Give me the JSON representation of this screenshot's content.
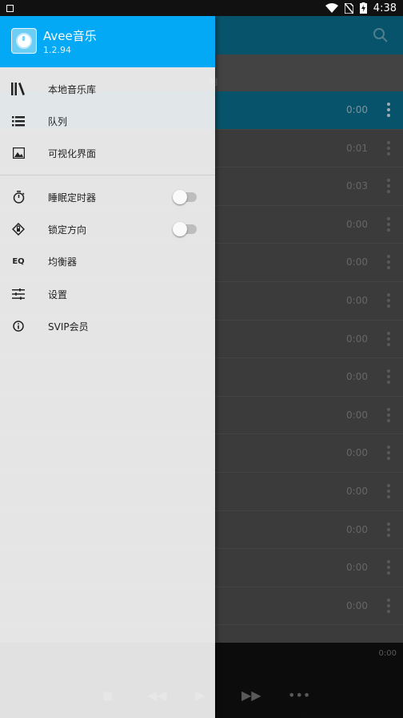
{
  "status_bar": {
    "time": "4:38"
  },
  "drawer": {
    "app_name": "Avee音乐",
    "version": "1.2.94",
    "menu": [
      {
        "label": "本地音乐库",
        "icon": "library-icon"
      },
      {
        "label": "队列",
        "icon": "queue-list-icon"
      },
      {
        "label": "可视化界面",
        "icon": "image-icon"
      },
      {
        "label": "睡眠定时器",
        "icon": "timer-icon",
        "toggle": false
      },
      {
        "label": "锁定方向",
        "icon": "rotation-lock-icon",
        "toggle": false
      },
      {
        "label": "均衡器",
        "icon": "equalizer-icon",
        "icon_text": "EQ"
      },
      {
        "label": "设置",
        "icon": "sliders-icon"
      },
      {
        "label": "SVIP会员",
        "icon": "info-icon"
      }
    ]
  },
  "background": {
    "tab_label": "列",
    "durations": [
      "0:00",
      "0:01",
      "0:03",
      "0:00",
      "0:00",
      "0:00",
      "0:00",
      "0:00",
      "0:00",
      "0:00",
      "0:00",
      "0:00",
      "0:00",
      "0:00"
    ],
    "player_time": "0:00"
  },
  "colors": {
    "accent": "#03a9f4",
    "app_bar": "#0a6f8f"
  }
}
